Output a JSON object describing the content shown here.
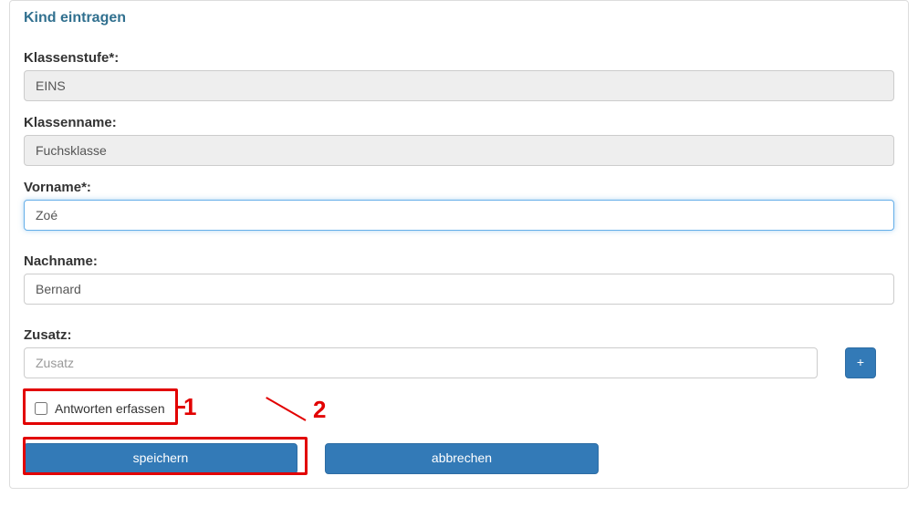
{
  "panel": {
    "title": "Kind eintragen"
  },
  "fields": {
    "klassenstufe": {
      "label": "Klassenstufe*:",
      "value": "EINS"
    },
    "klassenname": {
      "label": "Klassenname:",
      "value": "Fuchsklasse"
    },
    "vorname": {
      "label": "Vorname*:",
      "value": "Zoé"
    },
    "nachname": {
      "label": "Nachname:",
      "value": "Bernard"
    },
    "zusatz": {
      "label": "Zusatz:",
      "value": "",
      "placeholder": "Zusatz"
    }
  },
  "buttons": {
    "plus": "+",
    "antworten_erfassen": "Antworten erfassen",
    "speichern": "speichern",
    "abbrechen": "abbrechen"
  },
  "annotations": {
    "one": "1",
    "two": "2"
  }
}
